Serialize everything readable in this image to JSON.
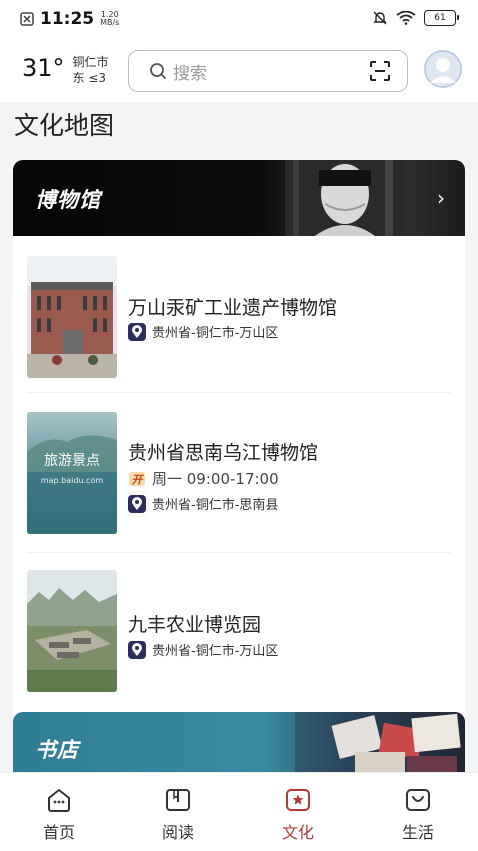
{
  "status": {
    "time": "11:25",
    "net_speed_value": "1.20",
    "net_speed_unit": "MB/s",
    "battery": "61"
  },
  "weather": {
    "temperature": "31°",
    "city": "铜仁市",
    "wind": "东 ≤3"
  },
  "search": {
    "placeholder": "搜索"
  },
  "page_title": "文化地图",
  "museum_section": {
    "title": "博物馆",
    "items": [
      {
        "name": "万山汞矿工业遗产博物馆",
        "hours": "",
        "location": "贵州省-铜仁市-万山区",
        "thumb_text": ""
      },
      {
        "name": "贵州省思南乌江博物馆",
        "hours": "周一 09:00-17:00",
        "location": "贵州省-铜仁市-思南县",
        "thumb_text": "旅游景点",
        "thumb_subtext": "map.baidu.com"
      },
      {
        "name": "九丰农业博览园",
        "hours": "",
        "location": "贵州省-铜仁市-万山区",
        "thumb_text": ""
      }
    ]
  },
  "bookstore_section": {
    "title": "书店"
  },
  "tabs": [
    {
      "label": "首页",
      "icon": "home-icon"
    },
    {
      "label": "阅读",
      "icon": "book-icon"
    },
    {
      "label": "文化",
      "icon": "culture-icon"
    },
    {
      "label": "生活",
      "icon": "life-icon"
    }
  ],
  "colors": {
    "active_tab": "#b43a3a",
    "location_pin_bg": "#2b2e5c",
    "museum_banner_bg": "#0a0a0a",
    "bookstore_banner_bg": "#2f7d92"
  }
}
